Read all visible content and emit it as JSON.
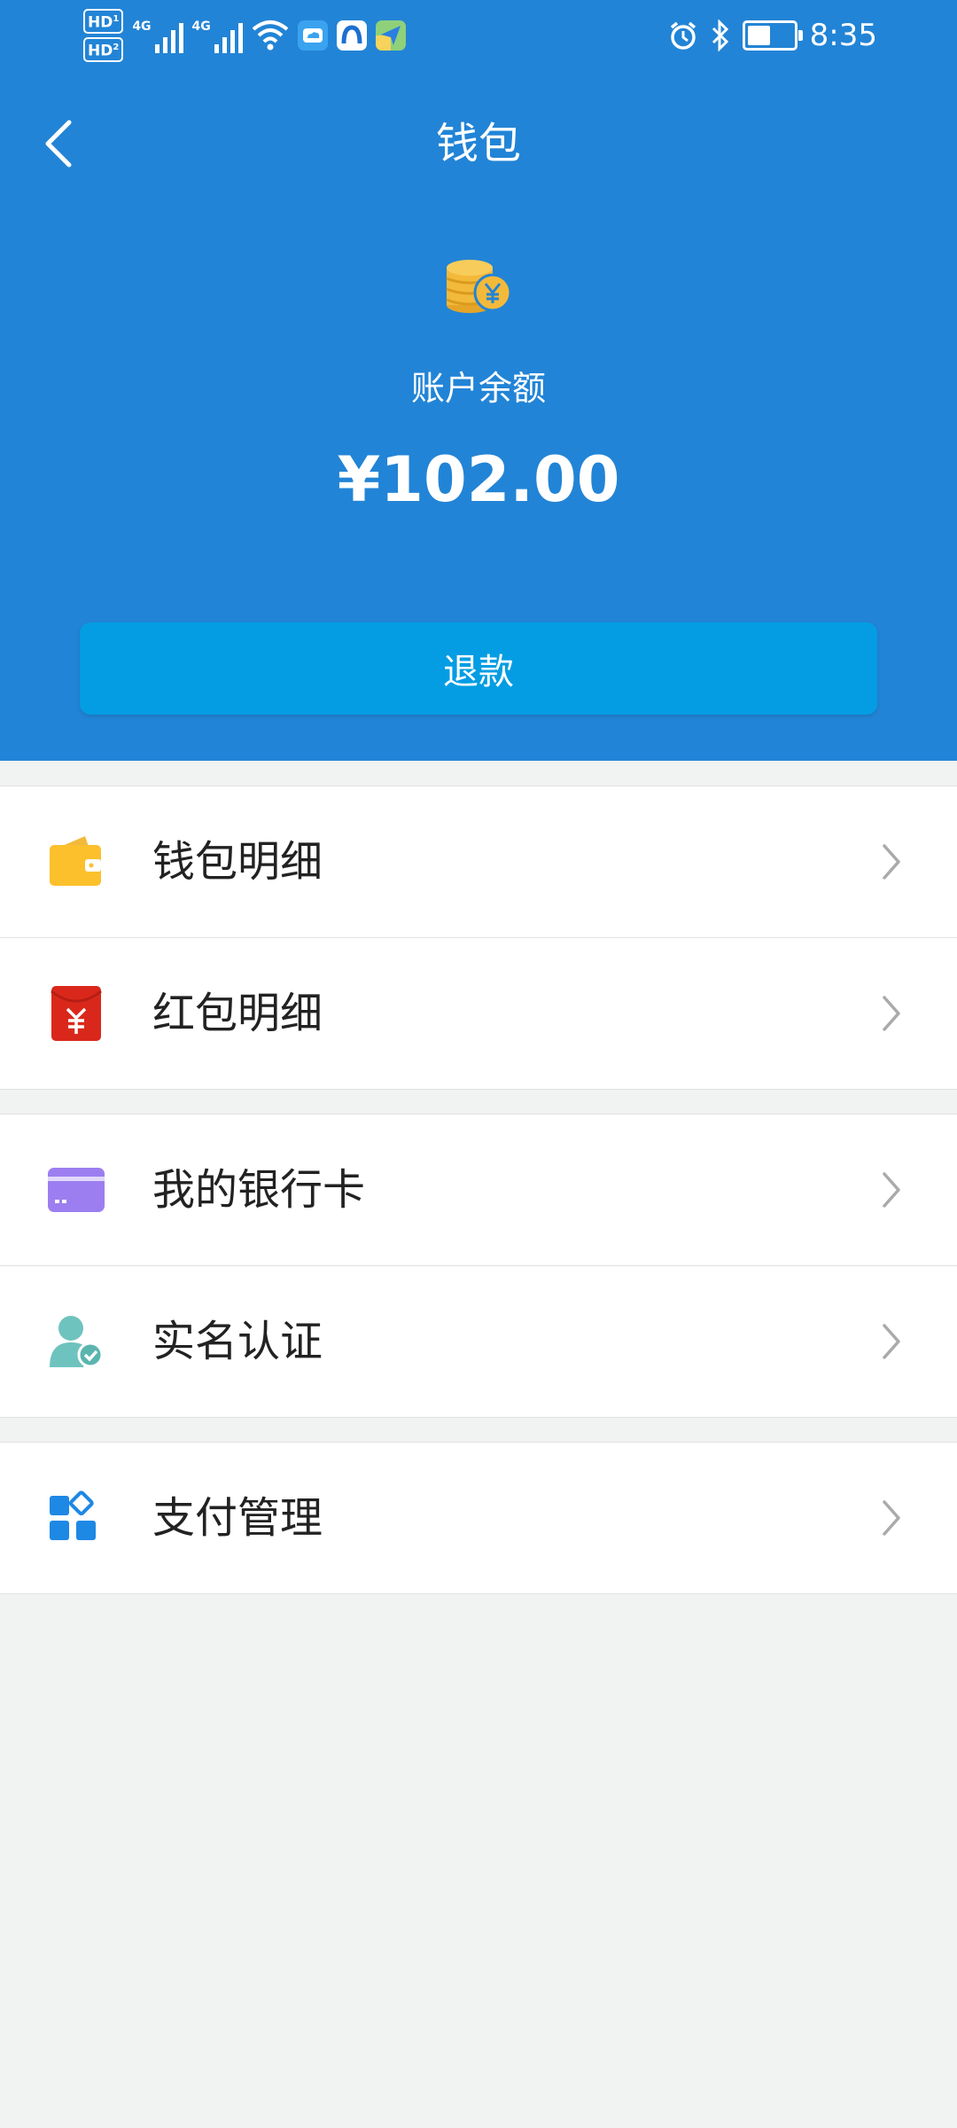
{
  "status_bar": {
    "hd1": "HD",
    "hd1_sub": "1",
    "hd2": "HD",
    "hd2_sub": "2",
    "net1": "4G",
    "net2": "4G",
    "time": "8:35",
    "battery_level": 0.45
  },
  "header": {
    "title": "钱包",
    "balance_label": "账户余额",
    "balance_value": "¥102.00",
    "refund_label": "退款"
  },
  "menu_groups": [
    {
      "items": [
        {
          "icon": "wallet-icon",
          "label": "钱包明细"
        },
        {
          "icon": "red-packet-icon",
          "label": "红包明细"
        }
      ]
    },
    {
      "items": [
        {
          "icon": "bank-card-icon",
          "label": "我的银行卡"
        },
        {
          "icon": "verified-user-icon",
          "label": "实名认证"
        }
      ]
    },
    {
      "items": [
        {
          "icon": "payment-manage-icon",
          "label": "支付管理"
        }
      ]
    }
  ],
  "colors": {
    "header_bg": "#2284d6",
    "refund_btn": "#049de3",
    "page_bg": "#f1f2f2",
    "wallet_icon": "#fcc02c",
    "red_packet_icon": "#d9281b",
    "bank_card_icon": "#9d7ef0",
    "verified_icon": "#6fc3be",
    "payment_icon": "#1e88e5",
    "coins_icon": "#f3b93a"
  }
}
